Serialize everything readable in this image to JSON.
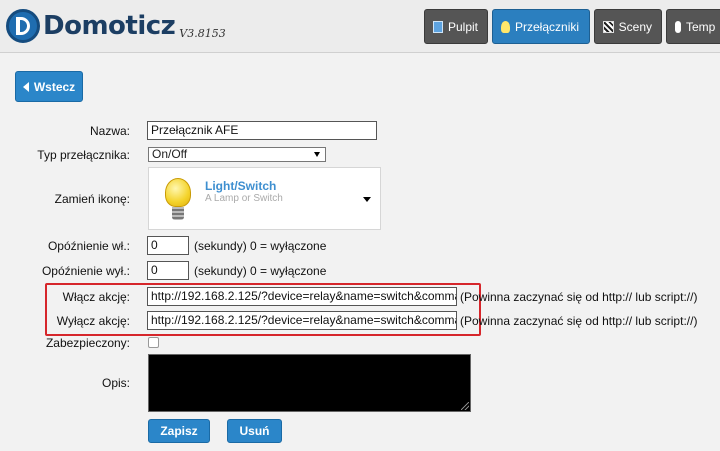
{
  "app": {
    "name": "Domoticz",
    "version": "V3.8153"
  },
  "nav": [
    {
      "label": "Pulpit",
      "icon": "monitor-icon",
      "active": false
    },
    {
      "label": "Przełączniki",
      "icon": "bulb-icon",
      "active": true
    },
    {
      "label": "Sceny",
      "icon": "clapperboard-icon",
      "active": false
    },
    {
      "label": "Temp",
      "icon": "thermometer-icon",
      "active": false
    }
  ],
  "back_label": "Wstecz",
  "form": {
    "name_label": "Nazwa:",
    "name_value": "Przełącznik AFE",
    "type_label": "Typ przełącznika:",
    "type_value": "On/Off",
    "icon_label": "Zamień ikonę:",
    "icon_title": "Light/Switch",
    "icon_sub": "A Lamp or Switch",
    "delay_on_label": "Opóźnienie wł.:",
    "delay_on_value": "0",
    "delay_on_note": "(sekundy) 0 = wyłączone",
    "delay_off_label": "Opóźnienie wył.:",
    "delay_off_value": "0",
    "delay_off_note": "(sekundy) 0 = wyłączone",
    "on_action_label": "Włącz akcję:",
    "on_action_value": "http://192.168.2.125/?device=relay&name=switch&comma",
    "on_action_note": "(Powinna zaczynać się od http:// lub script://)",
    "off_action_label": "Wyłącz akcję:",
    "off_action_value": "http://192.168.2.125/?device=relay&name=switch&comma",
    "off_action_note": "(Powinna zaczynać się od http:// lub script://)",
    "protected_label": "Zabezpieczony:",
    "description_label": "Opis:",
    "save_label": "Zapisz",
    "delete_label": "Usuń"
  },
  "colors": {
    "accent": "#2b86c9",
    "highlight": "#d6262b"
  }
}
